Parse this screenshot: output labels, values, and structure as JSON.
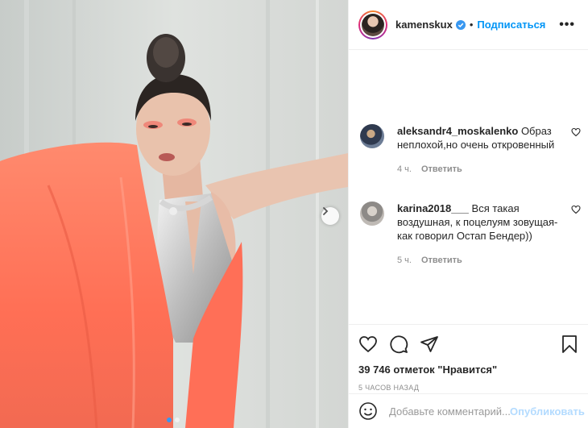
{
  "post": {
    "username": "kamenskux",
    "follow_label": "Подписаться",
    "separator": "•",
    "more_label": "•••"
  },
  "comments": [
    {
      "user": "aleksandr4_moskalenko",
      "text": "Образ неплохой,но очень откровенный",
      "time": "4 ч.",
      "reply_label": "Ответить"
    },
    {
      "user": "karina2018___",
      "text": "Вся такая воздушная, к поцелуям зовущая- как говорил Остап Бендер))",
      "time": "5 ч.",
      "reply_label": "Ответить"
    }
  ],
  "stats": {
    "likes": "39 746 отметок \"Нравится\"",
    "posted": "5 часов назад"
  },
  "add_comment": {
    "placeholder": "Добавьте комментарий...",
    "publish_label": "Опубликовать"
  },
  "carousel": {
    "current": 1,
    "total": 2
  },
  "colors": {
    "accent": "#0095f6",
    "publish_disabled": "#b3dbff",
    "carousel_active_dot": "#3897f0"
  },
  "icons": [
    "chevron-right-icon",
    "verified-icon",
    "heart-icon",
    "comment-icon",
    "share-icon",
    "bookmark-icon",
    "emoji-icon"
  ]
}
